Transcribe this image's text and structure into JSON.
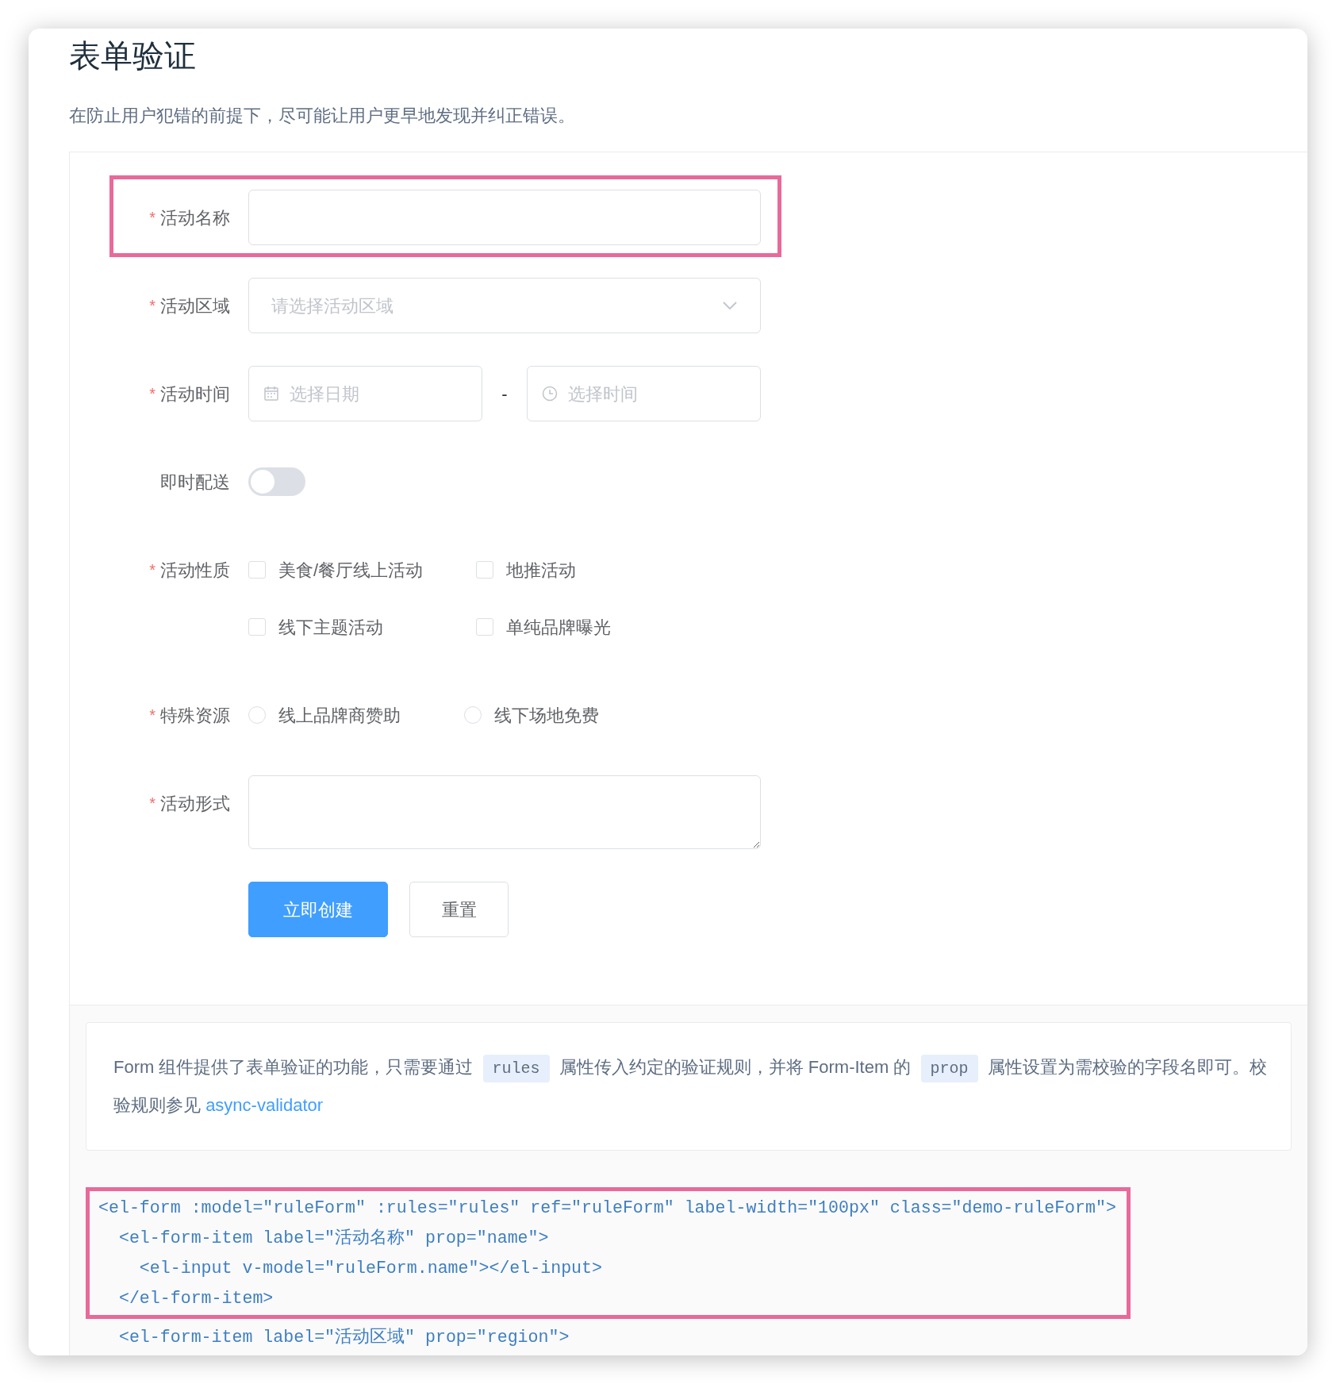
{
  "title": "表单验证",
  "description": "在防止用户犯错的前提下，尽可能让用户更早地发现并纠正错误。",
  "form": {
    "items": [
      {
        "kind": "input",
        "label": "活动名称",
        "required_mark": "*",
        "highlighted": true
      },
      {
        "kind": "select",
        "label": "活动区域",
        "required_mark": "*",
        "highlighted": false,
        "placeholder": "请选择活动区域"
      },
      {
        "kind": "datetime",
        "label": "活动时间",
        "required_mark": "*",
        "highlighted": false,
        "date_placeholder": "选择日期",
        "separator": "-",
        "time_placeholder": "选择时间"
      },
      {
        "kind": "switch",
        "label": "即时配送",
        "highlighted": false,
        "on": false
      },
      {
        "kind": "checkbox_group",
        "label": "活动性质",
        "required_mark": "*",
        "highlighted": false,
        "options": [
          {
            "label": "美食/餐厅线上活动",
            "checked": false
          },
          {
            "label": "地推活动",
            "checked": false
          },
          {
            "label": "线下主题活动",
            "checked": false
          },
          {
            "label": "单纯品牌曝光",
            "checked": false
          }
        ]
      },
      {
        "kind": "radio_group",
        "label": "特殊资源",
        "required_mark": "*",
        "highlighted": false,
        "options": [
          {
            "label": "线上品牌商赞助",
            "selected": false
          },
          {
            "label": "线下场地免费",
            "selected": false
          }
        ]
      },
      {
        "kind": "textarea",
        "label": "活动形式",
        "required_mark": "*",
        "highlighted": false
      }
    ],
    "buttons": [
      {
        "label": "立即创建",
        "kind": "primary"
      },
      {
        "label": "重置",
        "kind": "default"
      }
    ]
  },
  "explanation": [
    {
      "kind": "text",
      "text": "Form 组件提供了表单验证的功能，只需要通过"
    },
    {
      "kind": "code",
      "text": "rules"
    },
    {
      "kind": "text",
      "text": "属性传入约定的验证规则，并将 Form-Item 的"
    },
    {
      "kind": "code",
      "text": "prop"
    },
    {
      "kind": "text",
      "text": "属性设置为需校验的字段名即可。校验规则参见"
    },
    {
      "kind": "link",
      "text": "async-validator"
    }
  ],
  "code": [
    {
      "text": "<el-form :model=\"ruleForm\" :rules=\"rules\" ref=\"ruleForm\" label-width=\"100px\" class=\"demo-ruleForm\">",
      "highlighted": true
    },
    {
      "text": "  <el-form-item label=\"活动名称\" prop=\"name\">",
      "highlighted": true
    },
    {
      "text": "    <el-input v-model=\"ruleForm.name\"></el-input>",
      "highlighted": true
    },
    {
      "text": "  </el-form-item>",
      "highlighted": true
    },
    {
      "text": "  <el-form-item label=\"活动区域\" prop=\"region\">",
      "highlighted": false
    }
  ]
}
